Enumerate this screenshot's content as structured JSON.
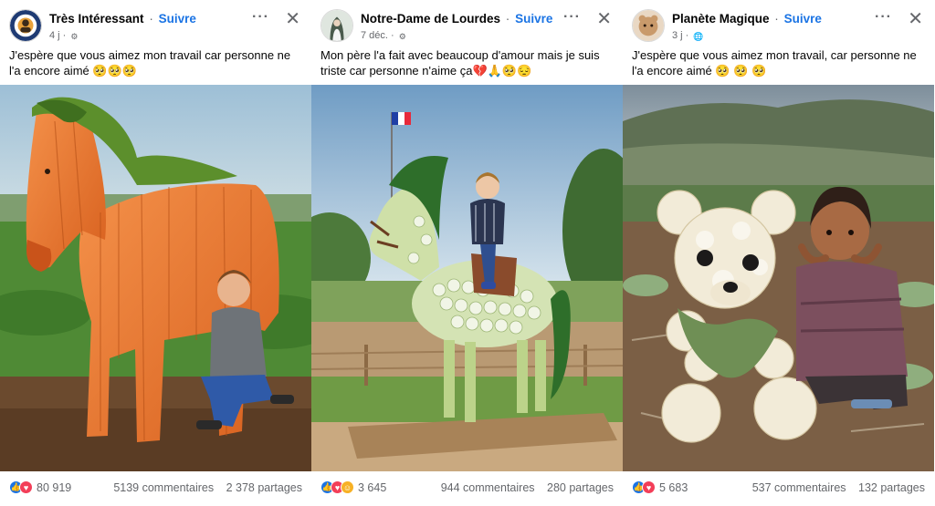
{
  "posts": [
    {
      "author": "Très Intéressant",
      "separator": "·",
      "follow_label": "Suivre",
      "time": "4 j ·",
      "caption": "J'espère que vous aimez mon travail car personne ne l'a encore aimé 🥺🥺🥺",
      "reaction_count": "80 919",
      "comments": "5139 commentaires",
      "shares": "2 378 partages",
      "reactions": [
        "like-icon",
        "love-icon"
      ]
    },
    {
      "author": "Notre-Dame de Lourdes",
      "separator": "·",
      "follow_label": "Suivre",
      "time": "7 déc. ·",
      "caption": "Mon père l'a fait avec beaucoup d'amour mais je suis triste car personne n'aime ça💔🙏🥺😔",
      "reaction_count": "3 645",
      "comments": "944 commentaires",
      "shares": "280 partages",
      "reactions": [
        "like-icon",
        "love-icon",
        "care-icon"
      ]
    },
    {
      "author": "Planète Magique",
      "separator": "·",
      "follow_label": "Suivre",
      "time": "3 j ·",
      "caption": "J'espère que vous aimez mon travail, car personne ne l'a encore aimé 🥺 🥺 🥺",
      "reaction_count": "5 683",
      "comments": "537 commentaires",
      "shares": "132 partages",
      "reactions": [
        "like-icon",
        "love-icon"
      ]
    }
  ],
  "icons": {
    "more": "more-options-icon",
    "close": "close-icon",
    "privacy": "globe-icon"
  },
  "colors": {
    "follow": "#1b74e4",
    "like": "#1b74e4",
    "love": "#f33e58",
    "care": "#f7b125",
    "secondary_text": "#65676b"
  }
}
